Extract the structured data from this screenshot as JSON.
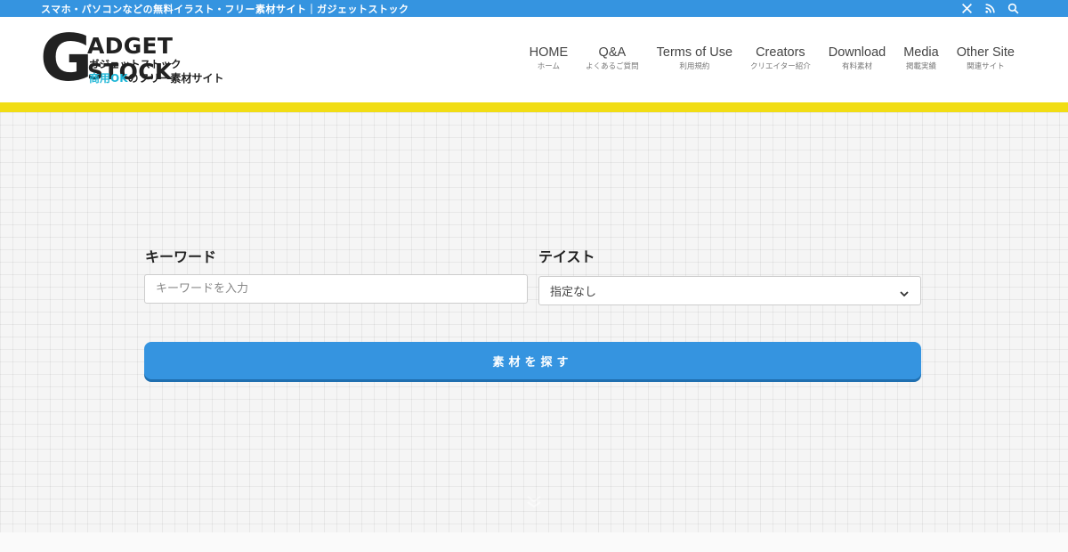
{
  "topbar": {
    "tagline": "スマホ・パソコンなどの無料イラスト・フリー素材サイト｜ガジェットストック",
    "icons": [
      "x-icon",
      "rss-icon",
      "search-icon"
    ]
  },
  "logo": {
    "letter": "G",
    "word": "ADGET STOCK",
    "kana": "ガジェットストック",
    "sub_prefix": "商用",
    "sub_ok": "OK",
    "sub_suffix": "のフリー素材サイト"
  },
  "nav": {
    "items": [
      {
        "en": "HOME",
        "jp": "ホーム"
      },
      {
        "en": "Q&A",
        "jp": "よくあるご質問"
      },
      {
        "en": "Terms of Use",
        "jp": "利用規約"
      },
      {
        "en": "Creators",
        "jp": "クリエイター紹介"
      },
      {
        "en": "Download",
        "jp": "有料素材"
      },
      {
        "en": "Media",
        "jp": "掲載実績"
      },
      {
        "en": "Other Site",
        "jp": "関連サイト"
      }
    ]
  },
  "search": {
    "keyword_label": "キーワード",
    "keyword_placeholder": "キーワードを入力",
    "taste_label": "テイスト",
    "taste_value": "指定なし",
    "button_label": "素材を探す"
  },
  "colors": {
    "accent_blue": "#3594e0",
    "accent_yellow": "#f1dd14",
    "ok_cyan": "#1fb6d6"
  }
}
